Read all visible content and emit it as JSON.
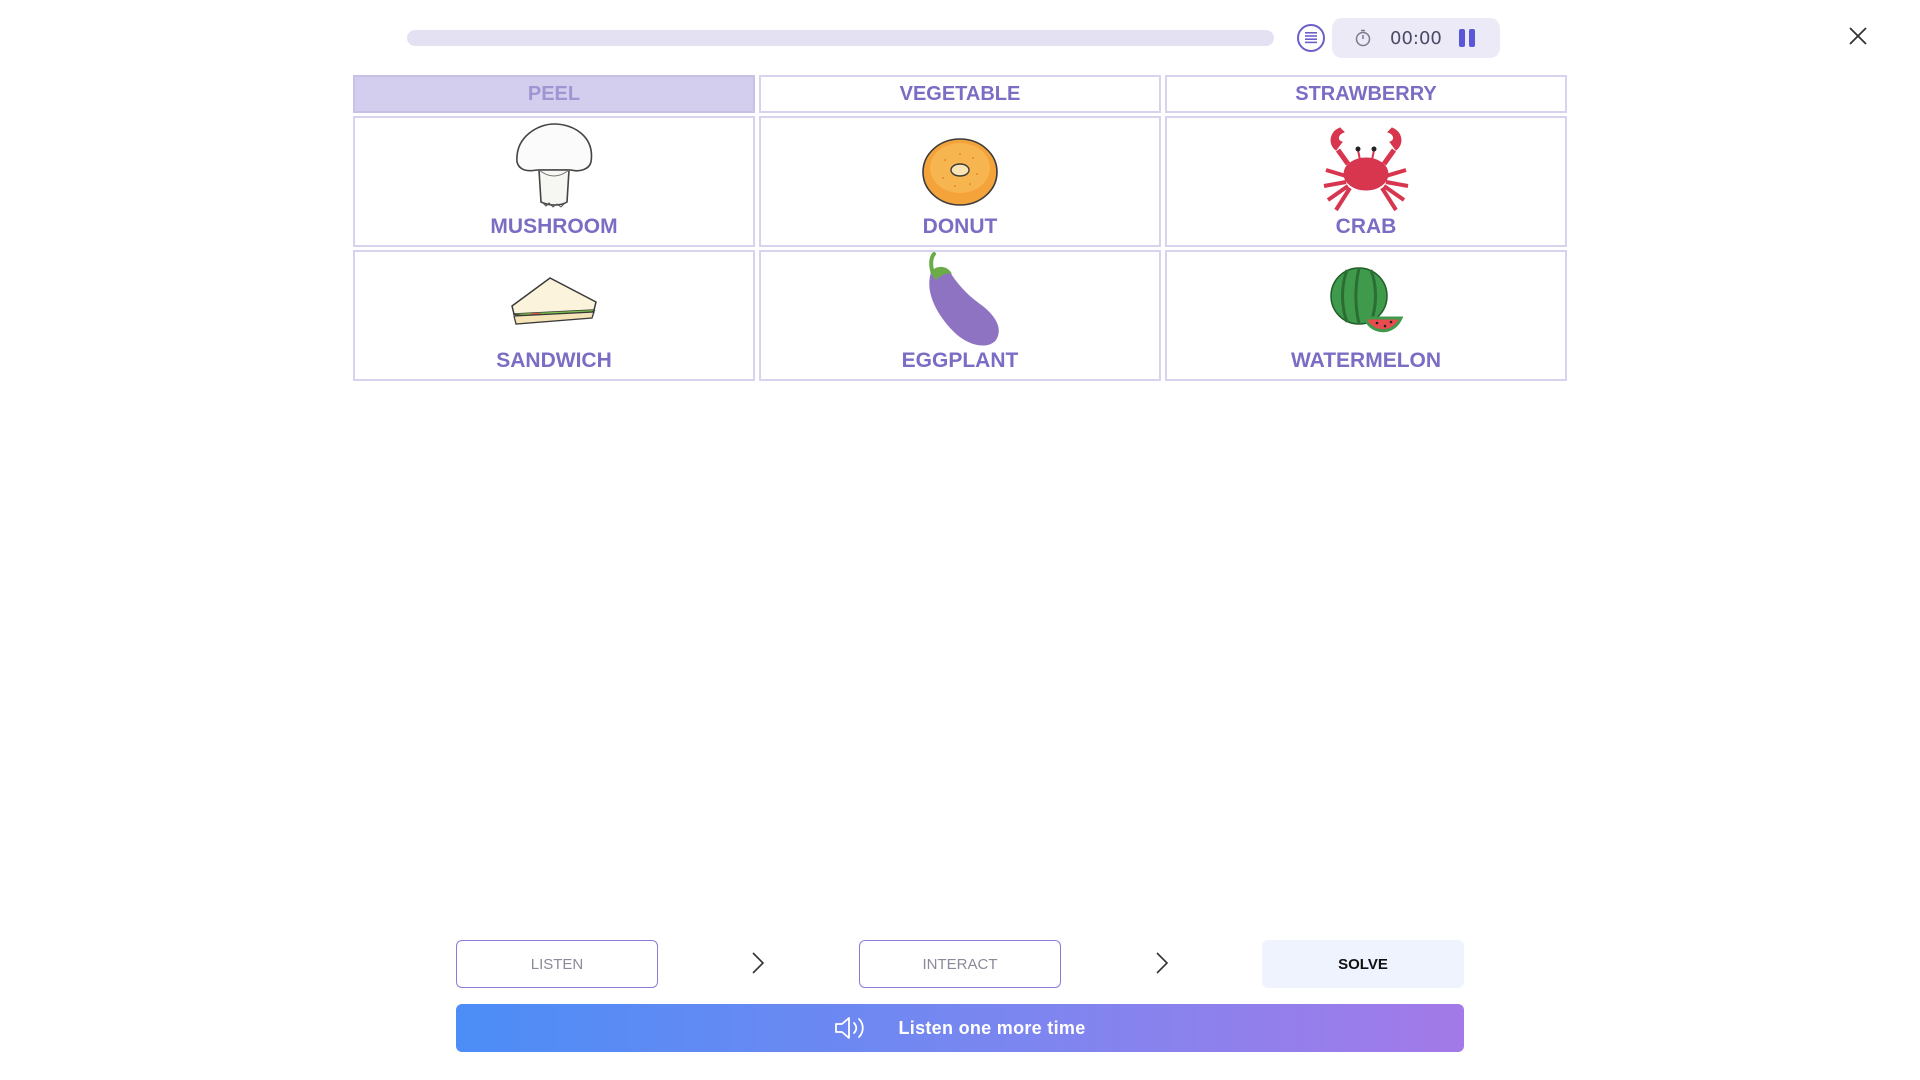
{
  "progress": {
    "fraction": 0.0
  },
  "timer": {
    "value": "00:00"
  },
  "columns": [
    {
      "label": "PEEL",
      "active": true
    },
    {
      "label": "VEGETABLE",
      "active": false
    },
    {
      "label": "STRAWBERRY",
      "active": false
    }
  ],
  "items": [
    {
      "label": "MUSHROOM",
      "icon": "mushroom-icon"
    },
    {
      "label": "DONUT",
      "icon": "donut-icon"
    },
    {
      "label": "CRAB",
      "icon": "crab-icon"
    },
    {
      "label": "SANDWICH",
      "icon": "sandwich-icon"
    },
    {
      "label": "EGGPLANT",
      "icon": "eggplant-icon"
    },
    {
      "label": "WATERMELON",
      "icon": "watermelon-icon"
    }
  ],
  "steps": {
    "listen": "LISTEN",
    "interact": "INTERACT",
    "solve": "SOLVE"
  },
  "listen_again": {
    "label": "Listen one more time"
  },
  "colors": {
    "accent": "#7b6cc4",
    "header_active_bg": "#d3cdee",
    "gradient_start": "#4c8df6",
    "gradient_end": "#a37ae8"
  }
}
